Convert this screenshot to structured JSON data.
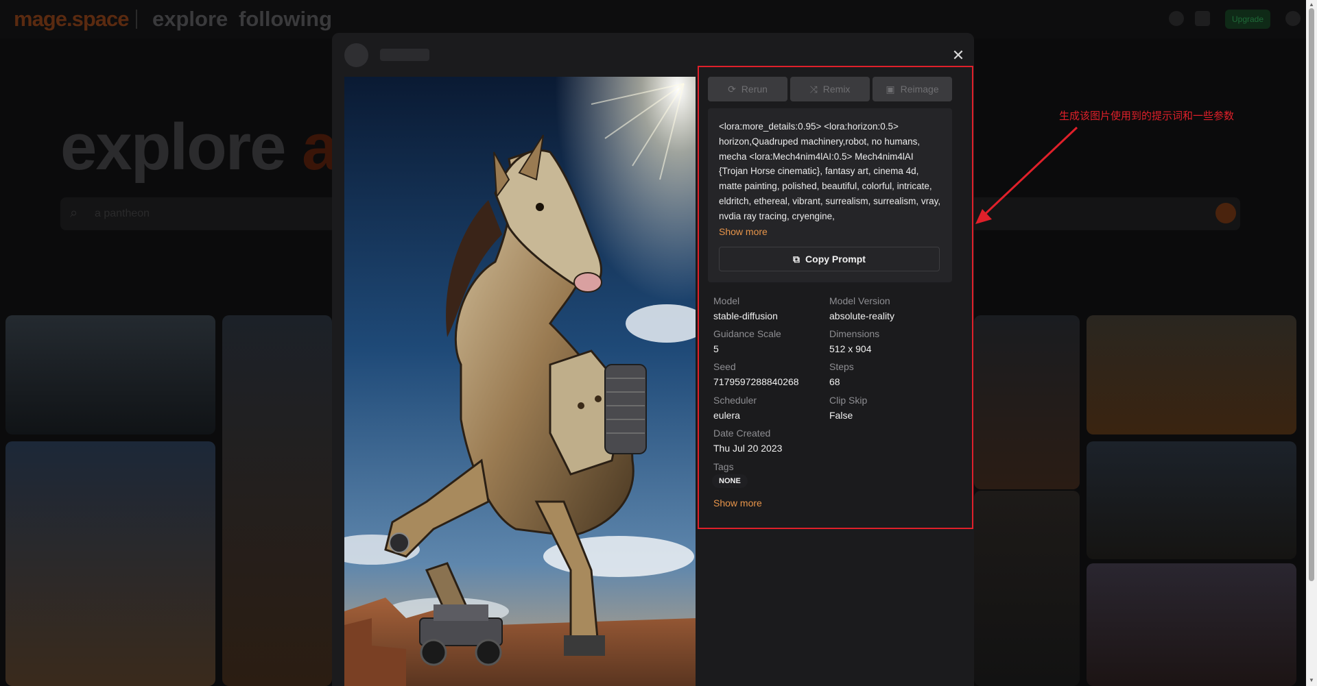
{
  "background": {
    "brand": "mage.space",
    "nav": {
      "explore": "explore",
      "following": "following"
    },
    "upgrade_label": "Upgrade",
    "hero": {
      "text": "explore",
      "accent": "a"
    },
    "search_placeholder": "a pantheon"
  },
  "modal": {
    "close_icon": "close-icon",
    "actions": [
      {
        "label": "Rerun",
        "icon": "refresh-icon"
      },
      {
        "label": "Remix",
        "icon": "shuffle-icon"
      },
      {
        "label": "Reimage",
        "icon": "image-icon"
      }
    ],
    "prompt": "<lora:more_details:0.95> <lora:horizon:0.5> horizon,Quadruped machinery,robot, no humans, mecha <lora:Mech4nim4lAI:0.5> Mech4nim4lAI {Trojan Horse cinematic}, fantasy art, cinema 4d, matte painting, polished, beautiful, colorful, intricate, eldritch, ethereal, vibrant, surrealism, surrealism, vray, nvdia ray tracing, cryengine,",
    "show_more_label": "Show more",
    "copy_prompt_label": "Copy Prompt",
    "details": {
      "model": {
        "label": "Model",
        "value": "stable-diffusion"
      },
      "model_version": {
        "label": "Model Version",
        "value": "absolute-reality"
      },
      "guidance_scale": {
        "label": "Guidance Scale",
        "value": "5"
      },
      "dimensions": {
        "label": "Dimensions",
        "value": "512 x 904"
      },
      "seed": {
        "label": "Seed",
        "value": "7179597288840268"
      },
      "steps": {
        "label": "Steps",
        "value": "68"
      },
      "scheduler": {
        "label": "Scheduler",
        "value": "eulera"
      },
      "clip_skip": {
        "label": "Clip Skip",
        "value": "False"
      },
      "date_created": {
        "label": "Date Created",
        "value": "Thu Jul 20 2023"
      },
      "tags": {
        "label": "Tags",
        "value": "NONE"
      }
    },
    "show_more_bottom_label": "Show more"
  },
  "annotation": {
    "text": "生成该图片使用到的提示词和一些参数",
    "color": "#e0202a"
  },
  "colors": {
    "accent": "#e8954a",
    "panel_bg": "#1b1b1d"
  }
}
